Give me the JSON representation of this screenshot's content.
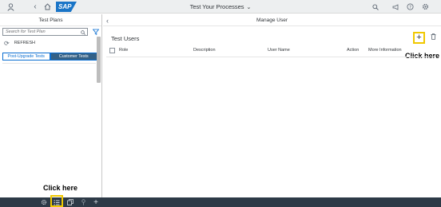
{
  "shellbar": {
    "app_title": "Test Your Processes",
    "title_chevron": "⌄",
    "logo_text": "SAP"
  },
  "left_panel": {
    "title": "Test Plans",
    "search_placeholder": "Search for Test Plan",
    "refresh_label": "REFRESH",
    "segments": [
      "Post-Upgrade Tests",
      "Customer Tests"
    ],
    "selected_segment": "Customer Tests"
  },
  "right_panel": {
    "title": "Manage User",
    "section_title": "Test Users",
    "columns": [
      "Role",
      "Description",
      "User Name",
      "Action",
      "More Information"
    ]
  },
  "annotations": {
    "right_callout": "Click here",
    "left_callout": "Click here"
  },
  "colors": {
    "brand_blue": "#1a75c7",
    "highlight_yellow": "#f0c800",
    "footer_bg": "#2d3a47",
    "selected_segment_bg": "#346187"
  },
  "icons": {
    "shell_left": [
      "user-icon",
      "home-icon"
    ],
    "shell_right": [
      "search-icon",
      "megaphone-icon",
      "help-icon",
      "settings-icon"
    ],
    "footer": [
      "settings-gear-icon",
      "list-icon",
      "copy-icon",
      "pin-icon",
      "add-icon"
    ]
  }
}
